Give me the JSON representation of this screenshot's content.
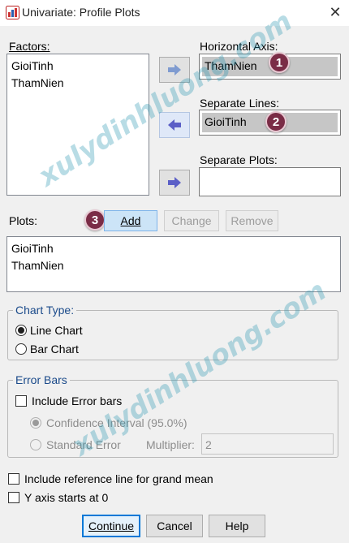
{
  "window": {
    "title": "Univariate: Profile Plots",
    "close_glyph": "✕"
  },
  "factors": {
    "label": "Factors:",
    "items": [
      "GioiTinh",
      "ThamNien"
    ]
  },
  "horizontal_axis": {
    "label": "Horizontal Axis:",
    "value": "ThamNien",
    "badge": "1"
  },
  "separate_lines": {
    "label": "Separate Lines:",
    "value": "GioiTinh",
    "badge": "2"
  },
  "separate_plots": {
    "label": "Separate Plots:",
    "value": ""
  },
  "plots": {
    "label": "Plots:",
    "badge": "3",
    "add_label": "Add",
    "change_label": "Change",
    "remove_label": "Remove",
    "items": [
      "GioiTinh",
      "ThamNien"
    ]
  },
  "chart_type": {
    "legend": "Chart Type:",
    "options": [
      "Line Chart",
      "Bar Chart"
    ],
    "selected": "Line Chart"
  },
  "error_bars": {
    "legend": "Error Bars",
    "include_label": "Include Error bars",
    "include_checked": false,
    "confidence_label": "Confidence Interval (95.0%)",
    "standard_error_label": "Standard Error",
    "multiplier_label": "Multiplier:",
    "multiplier_value": "2"
  },
  "options": {
    "reference_line_label": "Include reference line for grand mean",
    "reference_line_checked": false,
    "y_axis_zero_label": "Y axis starts at 0",
    "y_axis_zero_checked": false
  },
  "footer": {
    "continue_label": "Continue",
    "cancel_label": "Cancel",
    "help_label": "Help"
  },
  "watermark": {
    "text": "xulydinhluong.com"
  },
  "colors": {
    "badge": "#7a2c46",
    "arrow": "#5b5fc7",
    "legend_text": "#1a4a8a",
    "watermark": "#2896af"
  }
}
